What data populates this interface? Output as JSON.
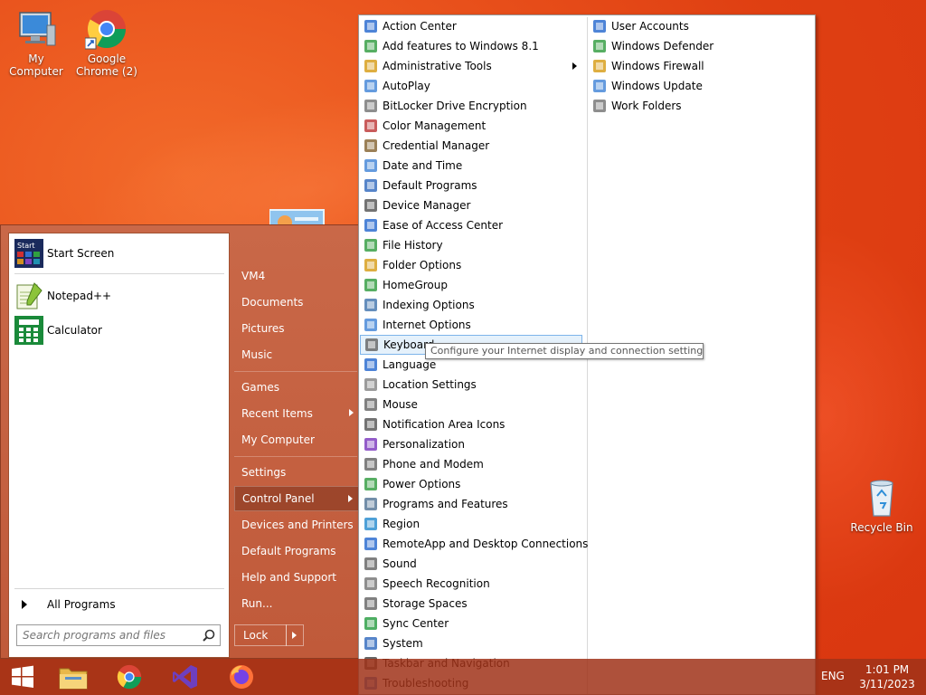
{
  "desktop": {
    "icons": [
      {
        "label": "My Computer"
      },
      {
        "label": "Google\nChrome (2)"
      },
      {
        "label": "Recycle Bin"
      }
    ]
  },
  "start_menu": {
    "pinned": [
      {
        "label": "Start Screen",
        "icon": "start-screen-icon",
        "icon_text": "Start"
      },
      {
        "label": "Notepad++",
        "icon": "notepad-plus-plus-icon"
      },
      {
        "label": "Calculator",
        "icon": "calculator-icon"
      }
    ],
    "all_programs": "All Programs",
    "search_placeholder": "Search programs and files",
    "right_items": [
      {
        "label": "VM4"
      },
      {
        "label": "Documents"
      },
      {
        "label": "Pictures"
      },
      {
        "label": "Music"
      },
      {
        "label": "Games"
      },
      {
        "label": "Recent Items",
        "submenu": true
      },
      {
        "label": "My Computer"
      },
      {
        "label": "Settings"
      },
      {
        "label": "Control Panel",
        "submenu": true,
        "active": true
      },
      {
        "label": "Devices and Printers"
      },
      {
        "label": "Default Programs"
      },
      {
        "label": "Help and Support"
      },
      {
        "label": "Run..."
      }
    ],
    "lock_label": "Lock"
  },
  "control_panel": {
    "column1": [
      {
        "label": "Action Center",
        "icon": "flag-icon"
      },
      {
        "label": "Add features to Windows 8.1",
        "icon": "add-features-icon"
      },
      {
        "label": "Administrative Tools",
        "icon": "folder-tools-icon",
        "submenu": true
      },
      {
        "label": "AutoPlay",
        "icon": "autoplay-icon"
      },
      {
        "label": "BitLocker Drive Encryption",
        "icon": "bitlocker-icon"
      },
      {
        "label": "Color Management",
        "icon": "color-management-icon"
      },
      {
        "label": "Credential Manager",
        "icon": "credential-manager-icon"
      },
      {
        "label": "Date and Time",
        "icon": "clock-icon"
      },
      {
        "label": "Default Programs",
        "icon": "default-programs-icon"
      },
      {
        "label": "Device Manager",
        "icon": "device-manager-icon"
      },
      {
        "label": "Ease of Access Center",
        "icon": "ease-of-access-icon"
      },
      {
        "label": "File History",
        "icon": "file-history-icon"
      },
      {
        "label": "Folder Options",
        "icon": "folder-options-icon"
      },
      {
        "label": "HomeGroup",
        "icon": "homegroup-icon"
      },
      {
        "label": "Indexing Options",
        "icon": "indexing-icon"
      },
      {
        "label": "Internet Options",
        "icon": "internet-options-icon"
      },
      {
        "label": "Keyboard",
        "icon": "keyboard-icon",
        "highlighted": true
      },
      {
        "label": "Language",
        "icon": "language-icon"
      },
      {
        "label": "Location Settings",
        "icon": "location-icon"
      },
      {
        "label": "Mouse",
        "icon": "mouse-icon"
      },
      {
        "label": "Notification Area Icons",
        "icon": "notification-icon"
      },
      {
        "label": "Personalization",
        "icon": "personalization-icon"
      },
      {
        "label": "Phone and Modem",
        "icon": "phone-modem-icon"
      },
      {
        "label": "Power Options",
        "icon": "power-options-icon"
      },
      {
        "label": "Programs and Features",
        "icon": "programs-features-icon"
      },
      {
        "label": "Region",
        "icon": "region-icon"
      },
      {
        "label": "RemoteApp and Desktop Connections",
        "icon": "remoteapp-icon"
      },
      {
        "label": "Sound",
        "icon": "sound-icon"
      },
      {
        "label": "Speech Recognition",
        "icon": "microphone-icon"
      },
      {
        "label": "Storage Spaces",
        "icon": "storage-spaces-icon"
      },
      {
        "label": "Sync Center",
        "icon": "sync-icon"
      },
      {
        "label": "System",
        "icon": "system-icon"
      },
      {
        "label": "Taskbar and Navigation",
        "icon": "taskbar-icon"
      },
      {
        "label": "Troubleshooting",
        "icon": "troubleshooting-icon"
      }
    ],
    "column2": [
      {
        "label": "User Accounts",
        "icon": "user-accounts-icon"
      },
      {
        "label": "Windows Defender",
        "icon": "windows-defender-icon"
      },
      {
        "label": "Windows Firewall",
        "icon": "firewall-icon"
      },
      {
        "label": "Windows Update",
        "icon": "windows-update-icon"
      },
      {
        "label": "Work Folders",
        "icon": "work-folders-icon"
      }
    ],
    "tooltip": "Configure your Internet display and connection settings."
  },
  "taskbar": {
    "apps": [
      "start-button",
      "file-explorer",
      "google-chrome",
      "visual-studio",
      "firefox"
    ],
    "language": "ENG",
    "time": "1:01 PM",
    "date": "3/11/2023"
  },
  "colors": {
    "accent": "#c05a3a",
    "desktop": "#e8501b",
    "highlight": "#e5f1fb"
  }
}
